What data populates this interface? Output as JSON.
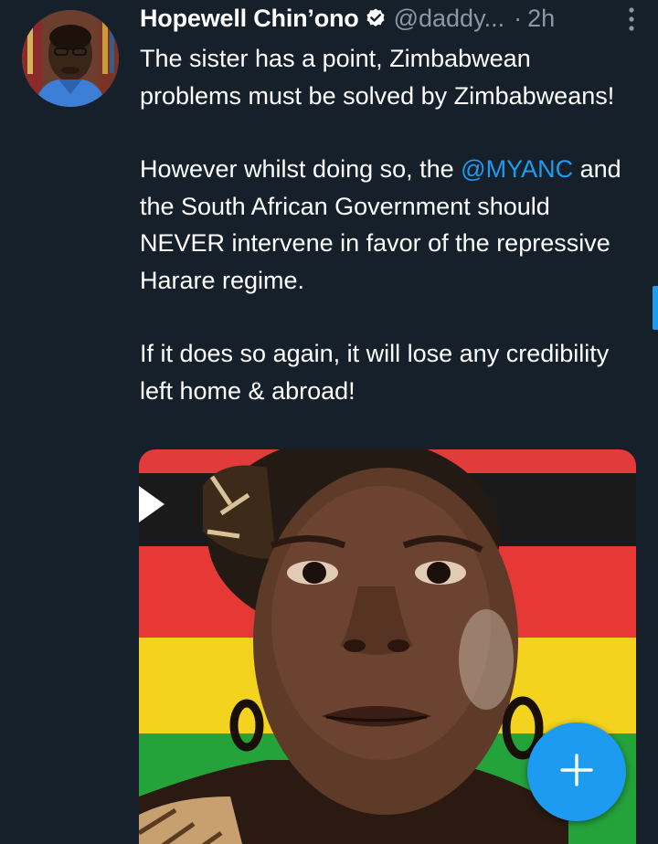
{
  "tweet": {
    "author_name": "Hopewell Chin’ono",
    "handle": "@daddy...",
    "separator": "·",
    "time": "2h",
    "paragraphs": [
      "The sister has a point, Zimbabwean problems must be solved by Zimbabweans!",
      "If it does so again, it will lose any credibility left home & abroad!"
    ],
    "paragraph2": {
      "before": "However whilst doing so, the ",
      "mention": "@MYANC",
      "after": " and the South African Government should NEVER intervene in favor of the repressive Harare regime."
    }
  },
  "icons": {
    "verified": "verified-badge-icon",
    "more": "more-vertical-icon",
    "compose": "plus-icon"
  },
  "colors": {
    "background": "#15202b",
    "text": "#ffffff",
    "secondary_text": "#8b98a5",
    "accent": "#1d9bf0"
  }
}
